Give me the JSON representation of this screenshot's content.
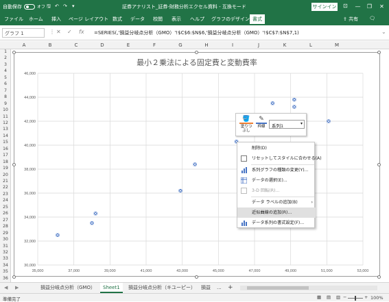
{
  "window": {
    "autosave_label": "自動保存",
    "autosave_state": "オフ",
    "title": "証券アナリスト_証券-財務分析エクセル資料 - 互換モード",
    "signin": "サインイン",
    "minimize": "—",
    "restore": "❐",
    "close": "✕"
  },
  "ribbon": {
    "tabs": [
      "ファイル",
      "ホーム",
      "挿入",
      "ページ レイアウト",
      "数式",
      "データ",
      "校閲",
      "表示",
      "ヘルプ",
      "グラフのデザイン",
      "書式"
    ],
    "active_tab": "書式",
    "share": "共有"
  },
  "formula_bar": {
    "name_box": "グラフ 1",
    "cancel": "✕",
    "enter": "✓",
    "fx": "fx",
    "formula": "=SERIES(,'損益分岐点分析（GMO）'!$C$6:$N$6,'損益分岐点分析（GMO）'!$C$7:$N$7,1)"
  },
  "columns": [
    "A",
    "B",
    "C",
    "D",
    "E",
    "F",
    "G",
    "H",
    "I",
    "J",
    "K",
    "L",
    "M"
  ],
  "rows": [
    "1",
    "2",
    "3",
    "4",
    "5",
    "6",
    "7",
    "8",
    "9",
    "10",
    "11",
    "12",
    "13",
    "14",
    "15",
    "16",
    "17",
    "18",
    "19",
    "20",
    "21",
    "22",
    "23",
    "24",
    "25",
    "26",
    "27",
    "28",
    "29",
    "30",
    "31",
    "32",
    "33",
    "34",
    "35",
    "36"
  ],
  "chart_data": {
    "type": "scatter",
    "title": "最小２乗法による固定費と変動費率",
    "xlim": [
      35000,
      53000
    ],
    "ylim": [
      30000,
      46000
    ],
    "xticks": [
      "35,000",
      "37,000",
      "39,000",
      "41,000",
      "43,000",
      "45,000",
      "47,000",
      "49,000",
      "51,000",
      "53,000"
    ],
    "yticks": [
      "30,000",
      "32,000",
      "34,000",
      "36,000",
      "38,000",
      "40,000",
      "42,000",
      "44,000",
      "46,000"
    ],
    "grid": true,
    "marker_color": "#4472c4",
    "series": [
      {
        "x": [
          36100,
          38000,
          38200,
          42900,
          43700,
          46000,
          48000,
          49200,
          49200,
          51100
        ],
        "y": [
          32500,
          33500,
          34300,
          36200,
          38400,
          40300,
          43500,
          43800,
          43200,
          42000
        ]
      }
    ]
  },
  "format_popup": {
    "fill_label": "塗りつぶし",
    "outline_label": "枠線",
    "series_select": "系列1"
  },
  "context_menu": {
    "items": [
      {
        "label": "削除(D)",
        "icon": "delete-icon",
        "state": "normal"
      },
      {
        "label": "リセットしてスタイルに合わせる(A)",
        "icon": "reset-style-icon",
        "state": "normal"
      },
      {
        "label": "系列グラフの種類の変更(Y)...",
        "icon": "chart-type-icon",
        "state": "normal"
      },
      {
        "label": "データの選択(E)...",
        "icon": "select-data-icon",
        "state": "normal"
      },
      {
        "label": "3-D 回転(R)...",
        "icon": "3d-rotation-icon",
        "state": "disabled"
      },
      {
        "label": "データ ラベルの追加(B)",
        "icon": "",
        "state": "submenu"
      },
      {
        "label": "近似曲線の追加(R)...",
        "icon": "",
        "state": "highlighted"
      },
      {
        "label": "データ系列の書式設定(F)...",
        "icon": "format-series-icon",
        "state": "normal"
      }
    ]
  },
  "sheet_tabs": {
    "tabs": [
      "損益分岐点分析（GMO）",
      "Sheet1",
      "損益分岐点分析（キユーピー）",
      "損益"
    ],
    "active": "Sheet1",
    "more": "...",
    "add": "+"
  },
  "status": {
    "ready": "準備完了",
    "zoom": "100%",
    "minus": "−",
    "plus": "+"
  }
}
